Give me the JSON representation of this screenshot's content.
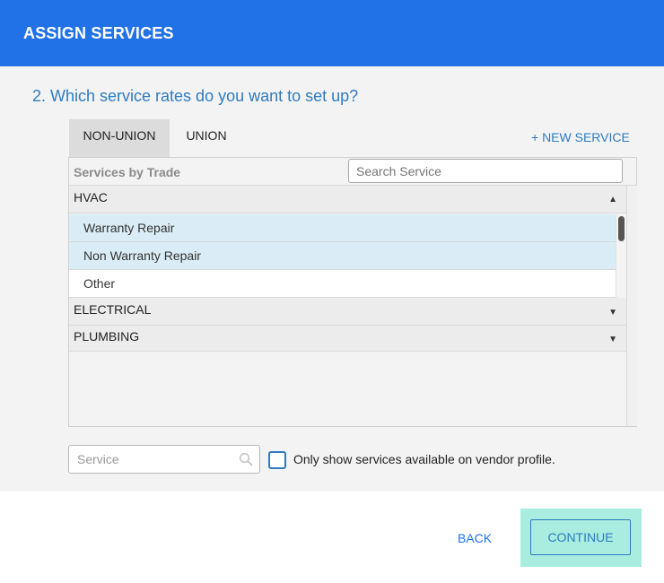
{
  "header": {
    "title": "ASSIGN SERVICES"
  },
  "question": "2. Which service rates do you want to set up?",
  "tabs": [
    {
      "label": "NON-UNION",
      "active": true
    },
    {
      "label": "UNION",
      "active": false
    }
  ],
  "new_service_link": "+ NEW SERVICE",
  "panel": {
    "header_label": "Services by Trade",
    "search_placeholder": "Search Service",
    "groups": [
      {
        "label": "HVAC",
        "expanded": true,
        "items": [
          {
            "label": "Warranty Repair",
            "selected": true
          },
          {
            "label": "Non Warranty Repair",
            "selected": true
          },
          {
            "label": "Other",
            "selected": false
          }
        ]
      },
      {
        "label": "ELECTRICAL",
        "expanded": false
      },
      {
        "label": "PLUMBING",
        "expanded": false
      }
    ]
  },
  "filter": {
    "service_placeholder": "Service",
    "checkbox_label": "Only show services available on vendor profile.",
    "checkbox_checked": false
  },
  "footer": {
    "back_label": "BACK",
    "continue_label": "CONTINUE"
  },
  "colors": {
    "header_bg": "#2171e7",
    "accent": "#2f7bbf",
    "selected_row": "#daecf5",
    "continue_highlight": "#a8eddf"
  },
  "icons": {
    "group_expanded": "caret-up-icon",
    "group_collapsed": "caret-down-icon",
    "filter_search": "search-icon"
  }
}
